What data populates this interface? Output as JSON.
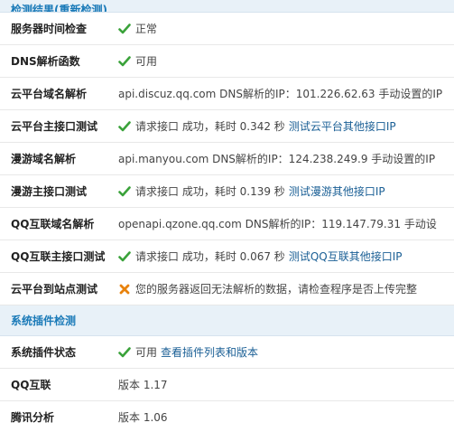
{
  "colors": {
    "header_bg": "#e8f1f8",
    "header_text": "#1a7ab8",
    "link": "#1a5f95",
    "ok_green": "#3aa23a",
    "error_orange": "#e8820c"
  },
  "top_section": {
    "title": "检测结果(重新检测)"
  },
  "rows_1": [
    {
      "label": "服务器时间检查",
      "icon": "check-icon",
      "text": "正常"
    },
    {
      "label": "DNS解析函数",
      "icon": "check-icon",
      "text": "可用"
    },
    {
      "label": "云平台域名解析",
      "text": "api.discuz.qq.com DNS解析的IP：101.226.62.63 手动设置的IP"
    },
    {
      "label": "云平台主接口测试",
      "icon": "check-icon",
      "text": "请求接口 成功，耗时 0.342 秒",
      "link": "测试云平台其他接口IP"
    },
    {
      "label": "漫游域名解析",
      "text": "api.manyou.com DNS解析的IP：124.238.249.9 手动设置的IP"
    },
    {
      "label": "漫游主接口测试",
      "icon": "check-icon",
      "text": "请求接口 成功，耗时 0.139 秒",
      "link": "测试漫游其他接口IP"
    },
    {
      "label": "QQ互联域名解析",
      "text": "openapi.qzone.qq.com DNS解析的IP：119.147.79.31 手动设"
    },
    {
      "label": "QQ互联主接口测试",
      "icon": "check-icon",
      "text": "请求接口 成功，耗时 0.067 秒",
      "link": "测试QQ互联其他接口IP"
    },
    {
      "label": "云平台到站点测试",
      "icon": "error-icon",
      "text": "您的服务器返回无法解析的数据，请检查程序是否上传完整"
    }
  ],
  "plugin_section": {
    "title": "系统插件检测"
  },
  "rows_2": [
    {
      "label": "系统插件状态",
      "icon": "check-icon",
      "text": "可用",
      "link": "查看插件列表和版本"
    },
    {
      "label": "QQ互联",
      "text": "版本 1.17"
    },
    {
      "label": "腾讯分析",
      "text": "版本 1.06"
    }
  ]
}
